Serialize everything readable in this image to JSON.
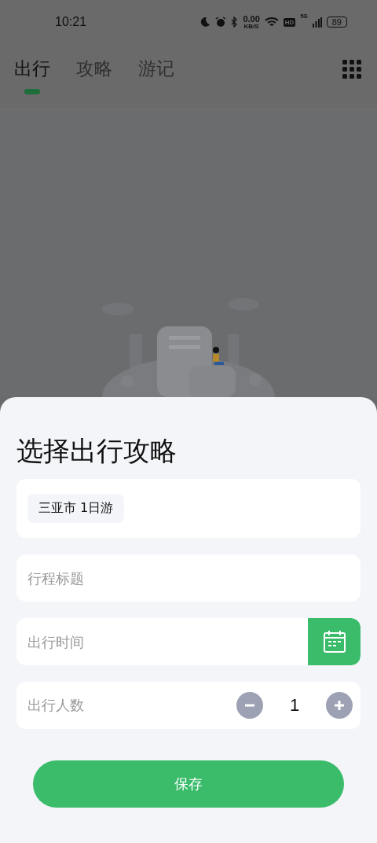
{
  "status_bar": {
    "time": "10:21",
    "net_speed": "0.00",
    "net_unit": "KB/S",
    "hd": "HD",
    "network": "5G",
    "battery": "89"
  },
  "tabs": [
    {
      "label": "出行",
      "selected": true
    },
    {
      "label": "攻略",
      "selected": false
    },
    {
      "label": "游记",
      "selected": false
    }
  ],
  "sheet": {
    "title": "选择出行攻略",
    "guide_tag": "三亚市 1日游",
    "trip_title": {
      "placeholder": "行程标题"
    },
    "trip_time": {
      "placeholder": "出行时间"
    },
    "travelers": {
      "label": "出行人数",
      "count": "1"
    },
    "save_button": "保存"
  }
}
